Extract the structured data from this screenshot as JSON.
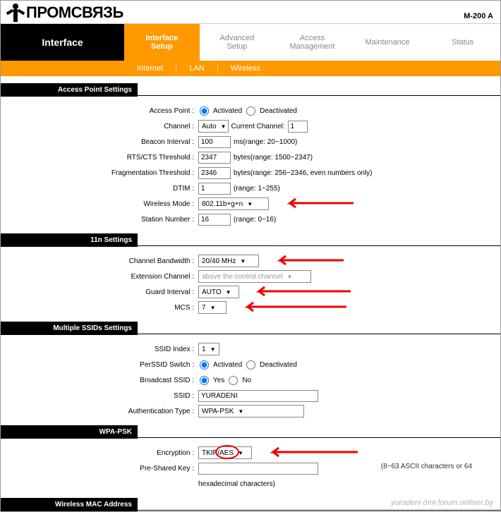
{
  "brand": "ПРОМСВЯЗЬ",
  "model": "M-200 A",
  "nav": {
    "title": "Interface",
    "tabs": [
      {
        "l1": "Interface",
        "l2": "Setup"
      },
      {
        "l1": "Advanced",
        "l2": "Setup"
      },
      {
        "l1": "Access",
        "l2": "Management"
      },
      {
        "l1": "Maintenance",
        "l2": ""
      },
      {
        "l1": "Status",
        "l2": ""
      }
    ],
    "sub": [
      "Internet",
      "LAN",
      "Wireless"
    ]
  },
  "sections": {
    "ap": "Access Point Settings",
    "n11": "11n Settings",
    "ssids": "Multiple SSIDs Settings",
    "wpa": "WPA-PSK",
    "mac": "Wireless MAC Address"
  },
  "ap": {
    "access_point_lbl": "Access Point :",
    "activated": "Activated",
    "deactivated": "Deactivated",
    "channel_lbl": "Channel :",
    "channel_val": "Auto",
    "current_channel_lbl": "Current Channel:",
    "current_channel_val": "1",
    "beacon_lbl": "Beacon Interval :",
    "beacon_val": "100",
    "beacon_hint": "ms(range: 20~1000)",
    "rts_lbl": "RTS/CTS Threshold :",
    "rts_val": "2347",
    "rts_hint": "bytes(range: 1500~2347)",
    "frag_lbl": "Fragmentation Threshold :",
    "frag_val": "2346",
    "frag_hint": "bytes(range: 256~2346, even numbers only)",
    "dtim_lbl": "DTIM :",
    "dtim_val": "1",
    "dtim_hint": "(range: 1~255)",
    "mode_lbl": "Wireless Mode :",
    "mode_val": "802.11b+g+n",
    "station_lbl": "Station Number :",
    "station_val": "16",
    "station_hint": "(range: 0~16)"
  },
  "n11": {
    "bw_lbl": "Channel Bandwidth :",
    "bw_val": "20/40 MHz",
    "ext_lbl": "Extension Channel :",
    "ext_val": "above the control channel",
    "guard_lbl": "Guard Interval :",
    "guard_val": "AUTO",
    "mcs_lbl": "MCS :",
    "mcs_val": "7"
  },
  "ssids": {
    "idx_lbl": "SSID Index :",
    "idx_val": "1",
    "perssid_lbl": "PerSSID Switch :",
    "broadcast_lbl": "Broadcast SSID :",
    "yes": "Yes",
    "no": "No",
    "ssid_lbl": "SSID :",
    "ssid_val": "YURADENI",
    "auth_lbl": "Authentication Type :",
    "auth_val": "WPA-PSK"
  },
  "wpa": {
    "enc_lbl": "Encryption :",
    "enc_val": "TKIP/AES",
    "psk_lbl": "Pre-Shared Key :",
    "psk_val": "",
    "ascii_hint": "(8~63 ASCII characters or 64",
    "hex_hint": "hexadecimal characters)"
  },
  "watermark": "yuradeni для forum.onliner.by"
}
